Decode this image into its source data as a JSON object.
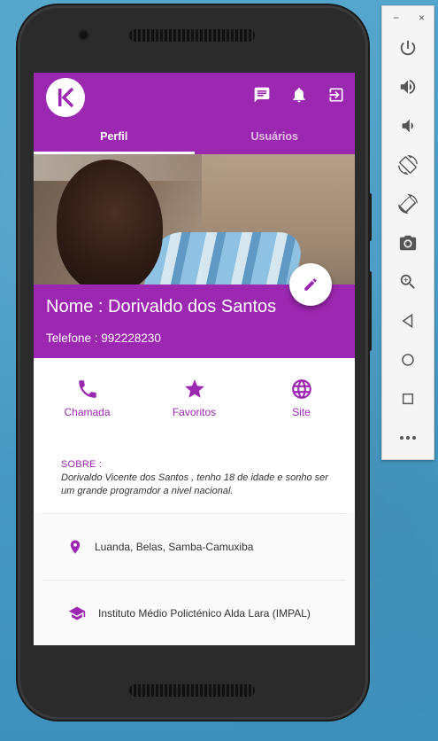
{
  "app": {
    "tabs": [
      {
        "label": "Perfil",
        "active": true
      },
      {
        "label": "Usuários",
        "active": false
      }
    ],
    "accent_color": "#9c27b0"
  },
  "header_icons": [
    "chat-icon",
    "bell-icon",
    "logout-icon"
  ],
  "profile": {
    "name": "Nome : Dorivaldo dos Santos",
    "phone": "Telefone : 992228230"
  },
  "actions": [
    {
      "label": "Chamada",
      "icon": "phone-icon"
    },
    {
      "label": "Favoritos",
      "icon": "star-icon"
    },
    {
      "label": "Site",
      "icon": "globe-icon"
    }
  ],
  "about": {
    "title": "SOBRE :",
    "text": "Dorivaldo Vicente dos Santos , tenho 18 de idade e sonho ser um grande programdor a nivel nacional."
  },
  "info": {
    "location": "Luanda, Belas, Samba-Camuxiba",
    "school": "Instituto Médio Policténico Alda Lara (IMPAL)"
  },
  "emulator": {
    "window_controls": [
      "−",
      "×"
    ],
    "buttons": [
      "power-icon",
      "volume-up-icon",
      "volume-down-icon",
      "rotate-left-icon",
      "rotate-right-icon",
      "camera-icon",
      "zoom-icon",
      "back-icon",
      "home-icon",
      "overview-icon",
      "more-icon"
    ]
  }
}
